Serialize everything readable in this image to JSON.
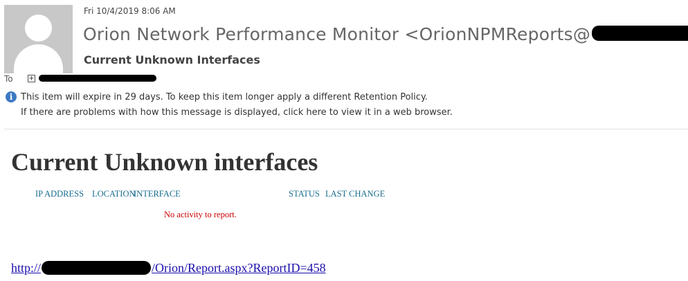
{
  "header": {
    "date": "Fri 10/4/2019 8:06 AM",
    "sender_prefix": "Orion Network Performance Monitor <OrionNPMReports@",
    "sender_suffix": ">",
    "subject": "Current Unknown Interfaces",
    "to_label": "To",
    "to_expand_icon": "plus-icon"
  },
  "info": {
    "icon": "info-icon",
    "line1": "This item will expire in 29 days. To keep this item longer apply a different Retention Policy.",
    "line2": "If there are problems with how this message is displayed, click here to view it in a web browser."
  },
  "report": {
    "title": "Current Unknown interfaces",
    "columns": [
      "IP ADDRESS",
      "LOCATION",
      "INTERFACE",
      "STATUS",
      "LAST CHANGE"
    ],
    "empty_message": "No activity to report.",
    "link_prefix": "http://",
    "link_suffix": "/Orion/Report.aspx?ReportID=458"
  },
  "colors": {
    "column_header": "#1a6d8f",
    "empty_message": "#cc0000",
    "link": "#1a0dab",
    "info_icon": "#3d79c2"
  }
}
